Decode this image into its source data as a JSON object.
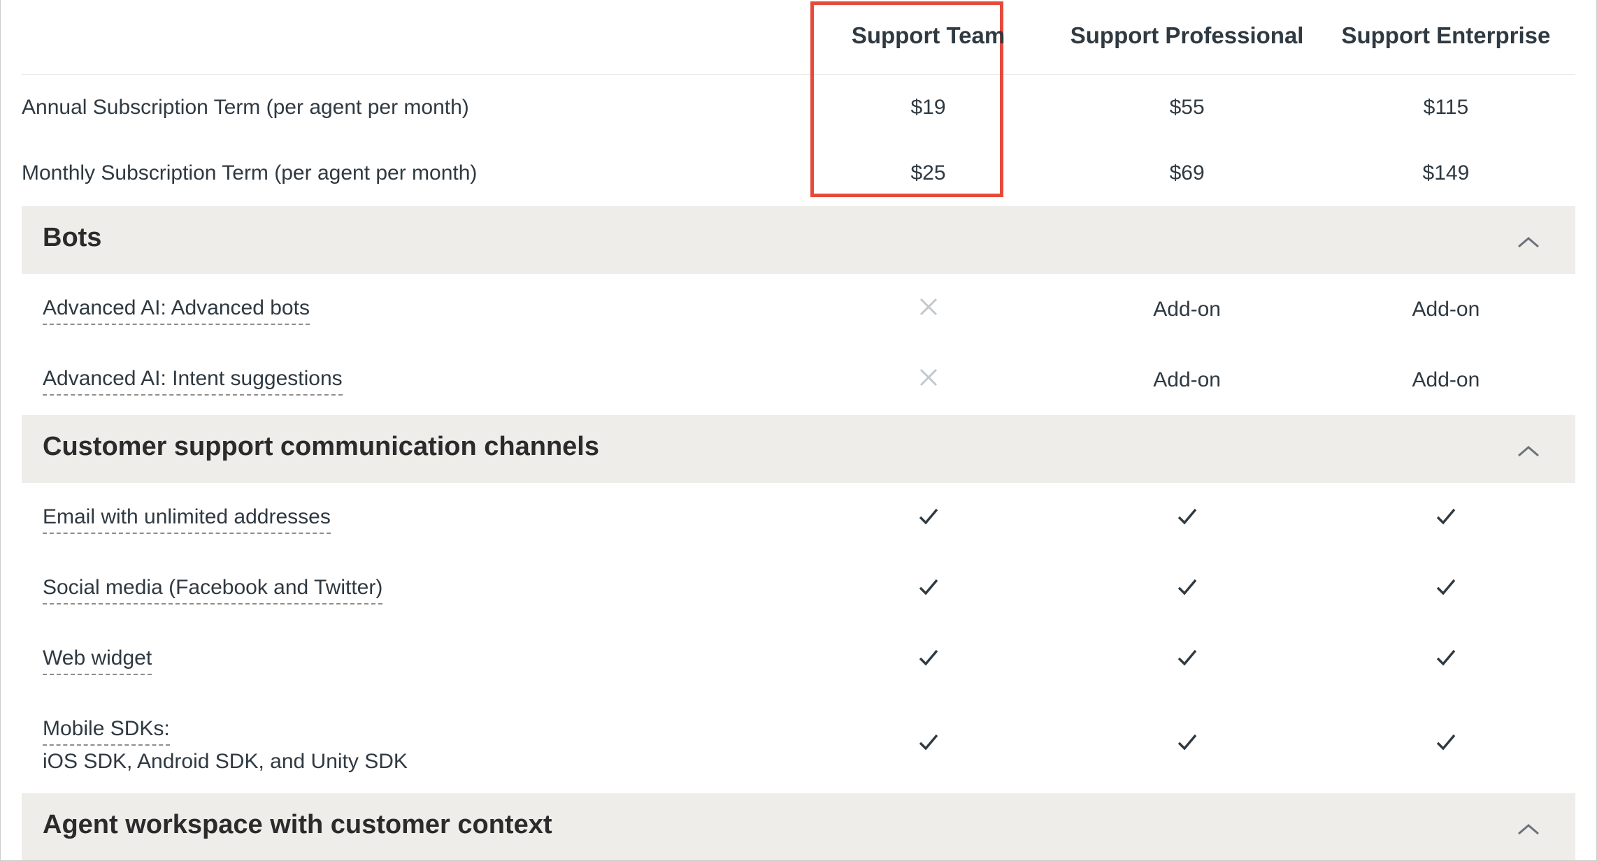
{
  "columns": {
    "c1": "Support Team",
    "c2": "Support Professional",
    "c3": "Support Enterprise"
  },
  "pricing_rows": {
    "annual": {
      "label": "Annual Subscription Term (per agent per month)",
      "c1": "$19",
      "c2": "$55",
      "c3": "$115"
    },
    "monthly": {
      "label": "Monthly Subscription Term (per agent per month)",
      "c1": "$25",
      "c2": "$69",
      "c3": "$149"
    }
  },
  "sections": {
    "bots": {
      "title": "Bots",
      "rows": {
        "advanced_bots": {
          "label": "Advanced AI: Advanced bots",
          "c1": "x",
          "c2": "Add-on",
          "c3": "Add-on"
        },
        "intent_suggestions": {
          "label": "Advanced AI: Intent suggestions",
          "c1": "x",
          "c2": "Add-on",
          "c3": "Add-on"
        }
      }
    },
    "channels": {
      "title": "Customer support communication channels",
      "rows": {
        "email": {
          "label": "Email with unlimited addresses",
          "c1": "check",
          "c2": "check",
          "c3": "check"
        },
        "social": {
          "label": "Social media (Facebook and Twitter)",
          "c1": "check",
          "c2": "check",
          "c3": "check"
        },
        "web_widget": {
          "label": "Web widget",
          "c1": "check",
          "c2": "check",
          "c3": "check"
        },
        "mobile_sdks": {
          "label": "Mobile SDKs:",
          "sub": "iOS SDK, Android SDK, and Unity SDK",
          "c1": "check",
          "c2": "check",
          "c3": "check"
        }
      }
    },
    "agent_workspace": {
      "title": "Agent workspace with customer context"
    }
  }
}
